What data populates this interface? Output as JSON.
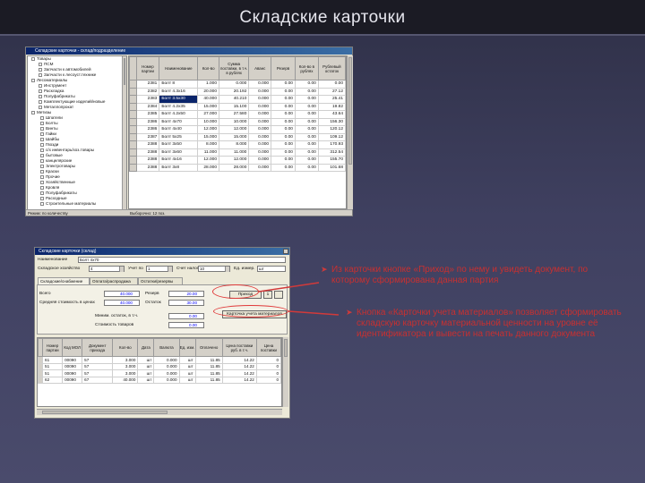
{
  "slide": {
    "title": "Складские карточки",
    "bullet1": "Из карточки кнопке «Приход» по нему и увидеть документ, по которому сформирована данная партия",
    "bullet2": "Кнопка «Карточки учета материалов» позволяет сформировать складскую карточку материальной ценности на уровне её идентификатора и вывести на печать данного документа",
    "accent_color": "#c93030",
    "bullet_icon": "arrow-bullet-icon"
  },
  "window1": {
    "title": "Складские карточки - склад/подразделение",
    "tree_items": [
      "Товары",
      "ПСМ",
      "Запчасти к автомобилей",
      "Запчасти к лесоуст.технике",
      "Лесоматериалы",
      "Инструмент",
      "Раскладка",
      "Полуфабрикаты",
      "Комплектующие изделий/новые",
      "Металлопрокат",
      "Метизы",
      "Шпатели",
      "Болты",
      "Винты",
      "Гайки",
      "Шайбы",
      "Гвозди",
      "с/х инвентарь/хоз.товары",
      "бытовые",
      "канцелярские",
      "Электротовары",
      "Краски",
      "Прочие",
      "Хозяйственные",
      "Кровля",
      "Полуфабрикаты",
      "Расходные",
      "Строительные материалы"
    ],
    "columns": [
      "Номер партии",
      "Наименование",
      "Кол-во",
      "Сумма поставки, в т.ч. в рублях",
      "Аванс",
      "Резерв",
      "Кол-во в рублях",
      "Рублевый остаток"
    ],
    "rows": [
      [
        "2381",
        "Болт 8",
        "1.000",
        "0.000",
        "0.000",
        "0.00",
        "0.00",
        "0.00"
      ],
      [
        "2382",
        "Болт 4.3х16",
        "20.000",
        "20.192",
        "0.000",
        "0.00",
        "0.00",
        "27.12"
      ],
      [
        "2383",
        "Болт 3.5х30",
        "40.000",
        "40.210",
        "0.000",
        "0.00",
        "0.00",
        "25.41"
      ],
      [
        "2384",
        "Болт 4.2х35",
        "15.000",
        "15.100",
        "0.000",
        "0.00",
        "0.00",
        "19.82"
      ],
      [
        "2385",
        "Болт 4.2х50",
        "27.000",
        "27.580",
        "0.000",
        "0.00",
        "0.00",
        "43.64"
      ],
      [
        "2386",
        "Болт 4х70",
        "10.000",
        "10.000",
        "0.000",
        "0.00",
        "0.00",
        "156.30"
      ],
      [
        "2386",
        "Болт 4х40",
        "12.000",
        "12.000",
        "0.000",
        "0.00",
        "0.00",
        "120.12"
      ],
      [
        "2387",
        "Болт 5х25",
        "15.000",
        "15.000",
        "0.000",
        "0.00",
        "0.00",
        "109.12"
      ],
      [
        "2388",
        "Болт 3х50",
        "8.000",
        "8.000",
        "0.000",
        "0.00",
        "0.00",
        "170.93"
      ],
      [
        "2388",
        "Болт 3х60",
        "11.000",
        "11.000",
        "0.000",
        "0.00",
        "0.00",
        "312.54"
      ],
      [
        "2388",
        "Болт 4х16",
        "12.000",
        "12.000",
        "0.000",
        "0.00",
        "0.00",
        "155.70"
      ],
      [
        "2388",
        "Болт 3х8",
        "28.000",
        "28.000",
        "0.000",
        "0.00",
        "0.00",
        "101.68"
      ]
    ],
    "status_left": "Режим: по количеству",
    "status_mid": "Выборочно: 12 поз."
  },
  "window2": {
    "title": "Складские карточки (склад)",
    "name_label": "Наименование",
    "name_value": "Болт 4х70",
    "subdiv_label": "Складское хозяйство",
    "subdiv_value": "4",
    "account_label": "Учет по",
    "account_value": "1",
    "subaccount_label": "Счет налог",
    "subaccount_value": "10",
    "unit_label": "Ед. измер.",
    "unit_value": "шт",
    "tabs": [
      "Складские/снабжение",
      "Оплата/распродажа",
      "Остатки/резервы"
    ],
    "field_total_label": "Всего",
    "field_total_value": "40.000",
    "field_reserve_label": "Резерв",
    "field_reserve_value": "20.00",
    "field_avg_label": "Средняя стоимость в ценах",
    "field_avg_value": "40.000",
    "field_sum_label": "Остаток",
    "field_sum_value": "30.00",
    "field_min_label": "Миним. остаток, в т.ч.",
    "field_min_value": "0.00",
    "field_last_label": "Стоимость товаров",
    "field_last_value": "0.00",
    "button_income": "Приход",
    "button_cards": "Карточка учета материалов",
    "button_small": "1",
    "columns": [
      "Номер партии",
      "Код МОЛ",
      "Документ прихода",
      "Кол-во",
      "Дата",
      "Валюта",
      "Ед. изм.",
      "Оплачено",
      "Цена поставки руб. в т.ч.",
      "Цена поставки"
    ],
    "rows": [
      [
        "61",
        "00090",
        "57",
        "3.000",
        "шт",
        "0.000",
        "шт",
        "11.85",
        "14.22",
        "0"
      ],
      [
        "51",
        "00090",
        "57",
        "3.000",
        "шт",
        "0.000",
        "шт",
        "11.85",
        "14.22",
        "0"
      ],
      [
        "51",
        "00090",
        "57",
        "3.000",
        "шт",
        "0.000",
        "шт",
        "11.85",
        "14.22",
        "0"
      ],
      [
        "62",
        "00090",
        "67",
        "40.000",
        "шт",
        "0.000",
        "шт",
        "11.85",
        "14.22",
        "0"
      ]
    ]
  }
}
